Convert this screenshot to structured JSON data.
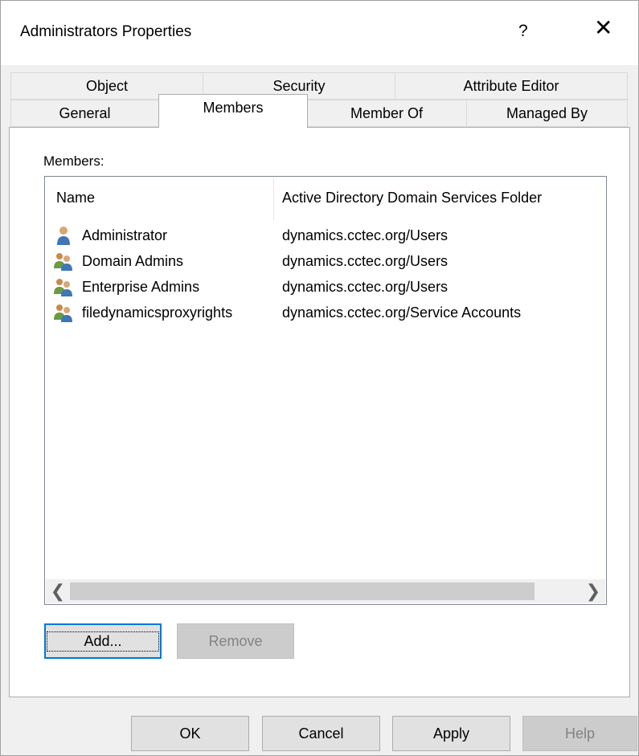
{
  "dialog": {
    "title": "Administrators Properties",
    "help_symbol": "?",
    "close_symbol": "✕"
  },
  "tabs": {
    "row_back": [
      "Object",
      "Security",
      "Attribute Editor"
    ],
    "row_front": [
      "General",
      "Members",
      "Member Of",
      "Managed By"
    ],
    "active": "Members"
  },
  "members_panel": {
    "label": "Members:",
    "columns": [
      "Name",
      "Active Directory Domain Services Folder"
    ],
    "rows": [
      {
        "name": "Administrator",
        "folder": "dynamics.cctec.org/Users",
        "icon": "user-icon"
      },
      {
        "name": "Domain Admins",
        "folder": "dynamics.cctec.org/Users",
        "icon": "group-icon"
      },
      {
        "name": "Enterprise Admins",
        "folder": "dynamics.cctec.org/Users",
        "icon": "group-icon"
      },
      {
        "name": "filedynamicsproxyrights",
        "folder": "dynamics.cctec.org/Service Accounts",
        "icon": "group-icon"
      }
    ],
    "scroll_left": "❮",
    "scroll_right": "❯",
    "add_label": "Add...",
    "remove_label": "Remove"
  },
  "footer": {
    "ok": "OK",
    "cancel": "Cancel",
    "apply": "Apply",
    "help": "Help"
  },
  "colors": {
    "dialog_bg": "#f0f0f0",
    "focus_blue": "#0078d7",
    "disabled_text": "#838383"
  }
}
